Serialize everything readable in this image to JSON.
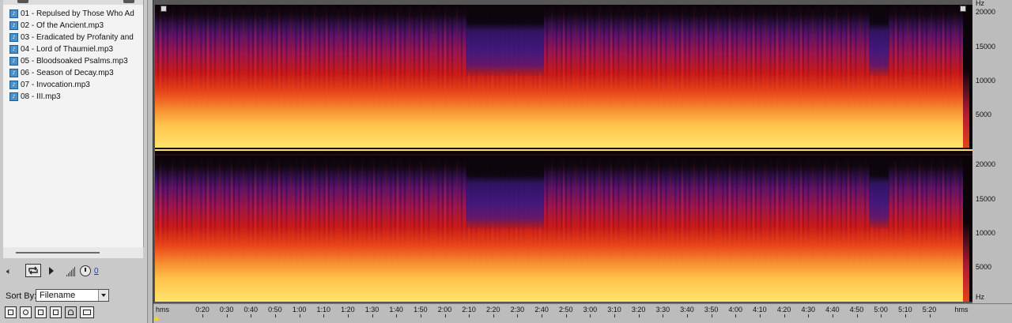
{
  "file_list": {
    "items": [
      {
        "label": "01 - Repulsed by Those Who Ad"
      },
      {
        "label": "02 - Of the Ancient.mp3"
      },
      {
        "label": "03 - Eradicated by Profanity and"
      },
      {
        "label": "04 - Lord of Thaumiel.mp3"
      },
      {
        "label": "05 - Bloodsoaked Psalms.mp3"
      },
      {
        "label": "06 - Season of Decay.mp3"
      },
      {
        "label": "07 - Invocation.mp3"
      },
      {
        "label": "08 - III.mp3"
      }
    ],
    "icon": "mp3-file-icon"
  },
  "transport": {
    "volume_value": "0"
  },
  "sort": {
    "label": "Sort By:",
    "selected": "Filename"
  },
  "spectrogram": {
    "unit_label": "Hz",
    "freq_labels": [
      "20000",
      "15000",
      "10000",
      "5000"
    ],
    "time_start_label": "hms",
    "time_end_label": "hms",
    "time_labels": [
      "0:20",
      "0:30",
      "0:40",
      "0:50",
      "1:00",
      "1:10",
      "1:20",
      "1:30",
      "1:40",
      "1:50",
      "2:00",
      "2:10",
      "2:20",
      "2:30",
      "2:40",
      "2:50",
      "3:00",
      "3:10",
      "3:20",
      "3:30",
      "3:40",
      "3:50",
      "4:00",
      "4:10",
      "4:20",
      "4:30",
      "4:40",
      "4:50",
      "5:00",
      "5:10",
      "5:20"
    ],
    "colors": {
      "low": "#ffe46c",
      "mid": "#cb1818",
      "high": "#62126c",
      "silence": "#0a0408"
    }
  }
}
